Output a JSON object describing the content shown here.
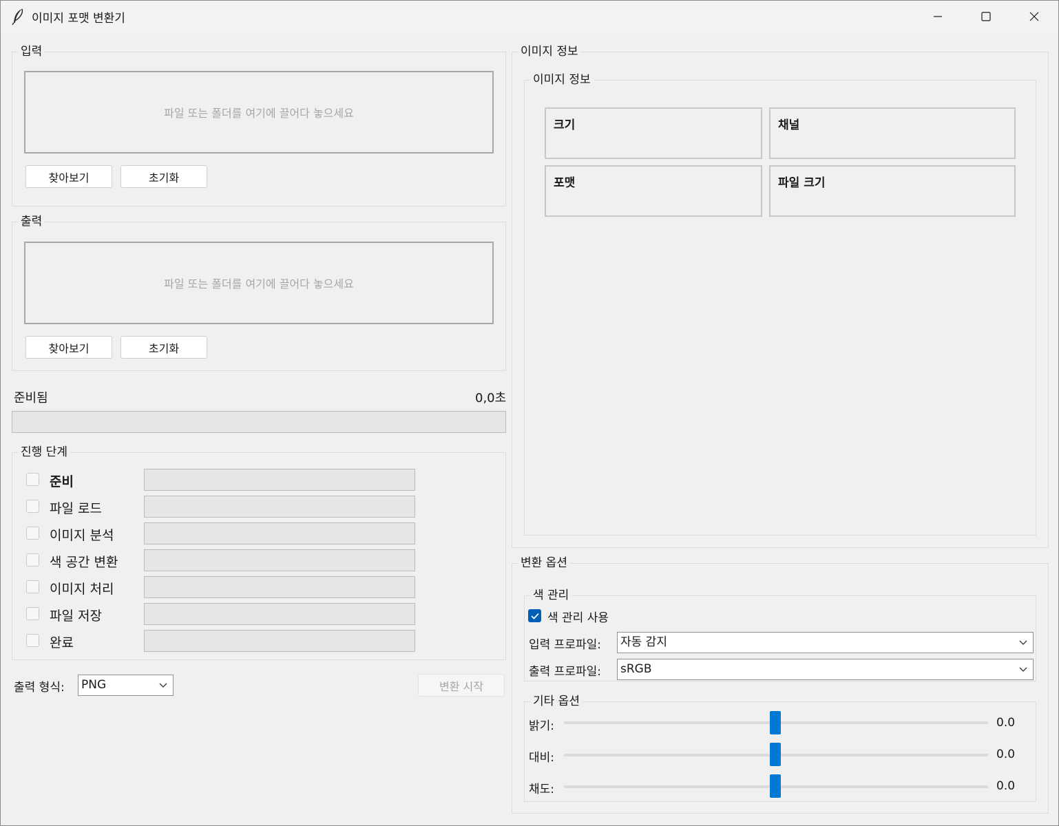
{
  "window": {
    "title": "이미지 포맷 변환기"
  },
  "input_section": {
    "label": "입력",
    "dropzone_text": "파일 또는 폴더를 여기에 끌어다 놓으세요",
    "browse_button": "찾아보기",
    "reset_button": "초기화"
  },
  "output_section": {
    "label": "출력",
    "dropzone_text": "파일 또는 폴더를 여기에 끌어다 놓으세요",
    "browse_button": "찾아보기",
    "reset_button": "초기화"
  },
  "status": {
    "text": "준비됨",
    "elapsed": "0,0초",
    "progress": 0
  },
  "steps": {
    "label": "진행 단계",
    "items": [
      {
        "label": "준비",
        "checked": false,
        "bold": true
      },
      {
        "label": "파일 로드",
        "checked": false,
        "bold": false
      },
      {
        "label": "이미지 분석",
        "checked": false,
        "bold": false
      },
      {
        "label": "색 공간 변환",
        "checked": false,
        "bold": false
      },
      {
        "label": "이미지 처리",
        "checked": false,
        "bold": false
      },
      {
        "label": "파일 저장",
        "checked": false,
        "bold": false
      },
      {
        "label": "완료",
        "checked": false,
        "bold": false
      }
    ]
  },
  "format": {
    "label": "출력 형식:",
    "selected": "PNG"
  },
  "convert_button": "변환 시작",
  "image_info": {
    "outer_label": "이미지 정보",
    "inner_label": "이미지 정보",
    "cells": {
      "size": "크기",
      "channels": "채널",
      "format": "포맷",
      "file_size": "파일 크기"
    }
  },
  "conversion_options": {
    "label": "변환 옵션",
    "color_management": {
      "label": "색 관리",
      "use_label": "색 관리 사용",
      "use_checked": true,
      "input_profile_label": "입력 프로파일:",
      "input_profile_value": "자동 감지",
      "output_profile_label": "출력 프로파일:",
      "output_profile_value": "sRGB"
    },
    "other": {
      "label": "기타 옵션",
      "brightness_label": "밝기:",
      "brightness_value": "0.0",
      "contrast_label": "대비:",
      "contrast_value": "0.0",
      "saturation_label": "채도:",
      "saturation_value": "0.0"
    }
  },
  "colors": {
    "accent": "#0078d4",
    "checkbox_checked": "#005fb8",
    "window_bg": "#f0f0f0"
  },
  "icons": {
    "app": "feather-icon",
    "minimize": "minimize-icon",
    "maximize": "maximize-icon",
    "close": "close-icon",
    "dropdown": "chevron-down-icon",
    "check": "check-icon"
  }
}
